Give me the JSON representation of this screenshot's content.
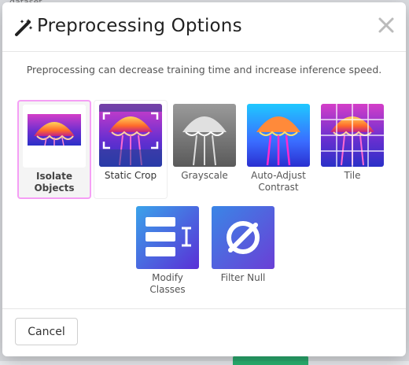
{
  "background": {
    "top_left_text": "dataset",
    "accent": "#2bb673"
  },
  "modal": {
    "title": "Preprocessing Options",
    "subtitle": "Preprocessing can decrease training time and increase inference speed.",
    "options": [
      {
        "label": "Isolate Objects",
        "selected": true
      },
      {
        "label": "Static Crop",
        "selected": false
      },
      {
        "label": "Grayscale",
        "selected": false
      },
      {
        "label": "Auto-Adjust Contrast",
        "selected": false
      },
      {
        "label": "Tile",
        "selected": false
      },
      {
        "label": "Modify Classes",
        "selected": false
      },
      {
        "label": "Filter Null",
        "selected": false
      }
    ],
    "cancel_label": "Cancel",
    "colors": {
      "selected_border": "#f59ff5",
      "icon_purple": "#5a3fd6",
      "icon_blue": "#3c7bd4"
    }
  }
}
